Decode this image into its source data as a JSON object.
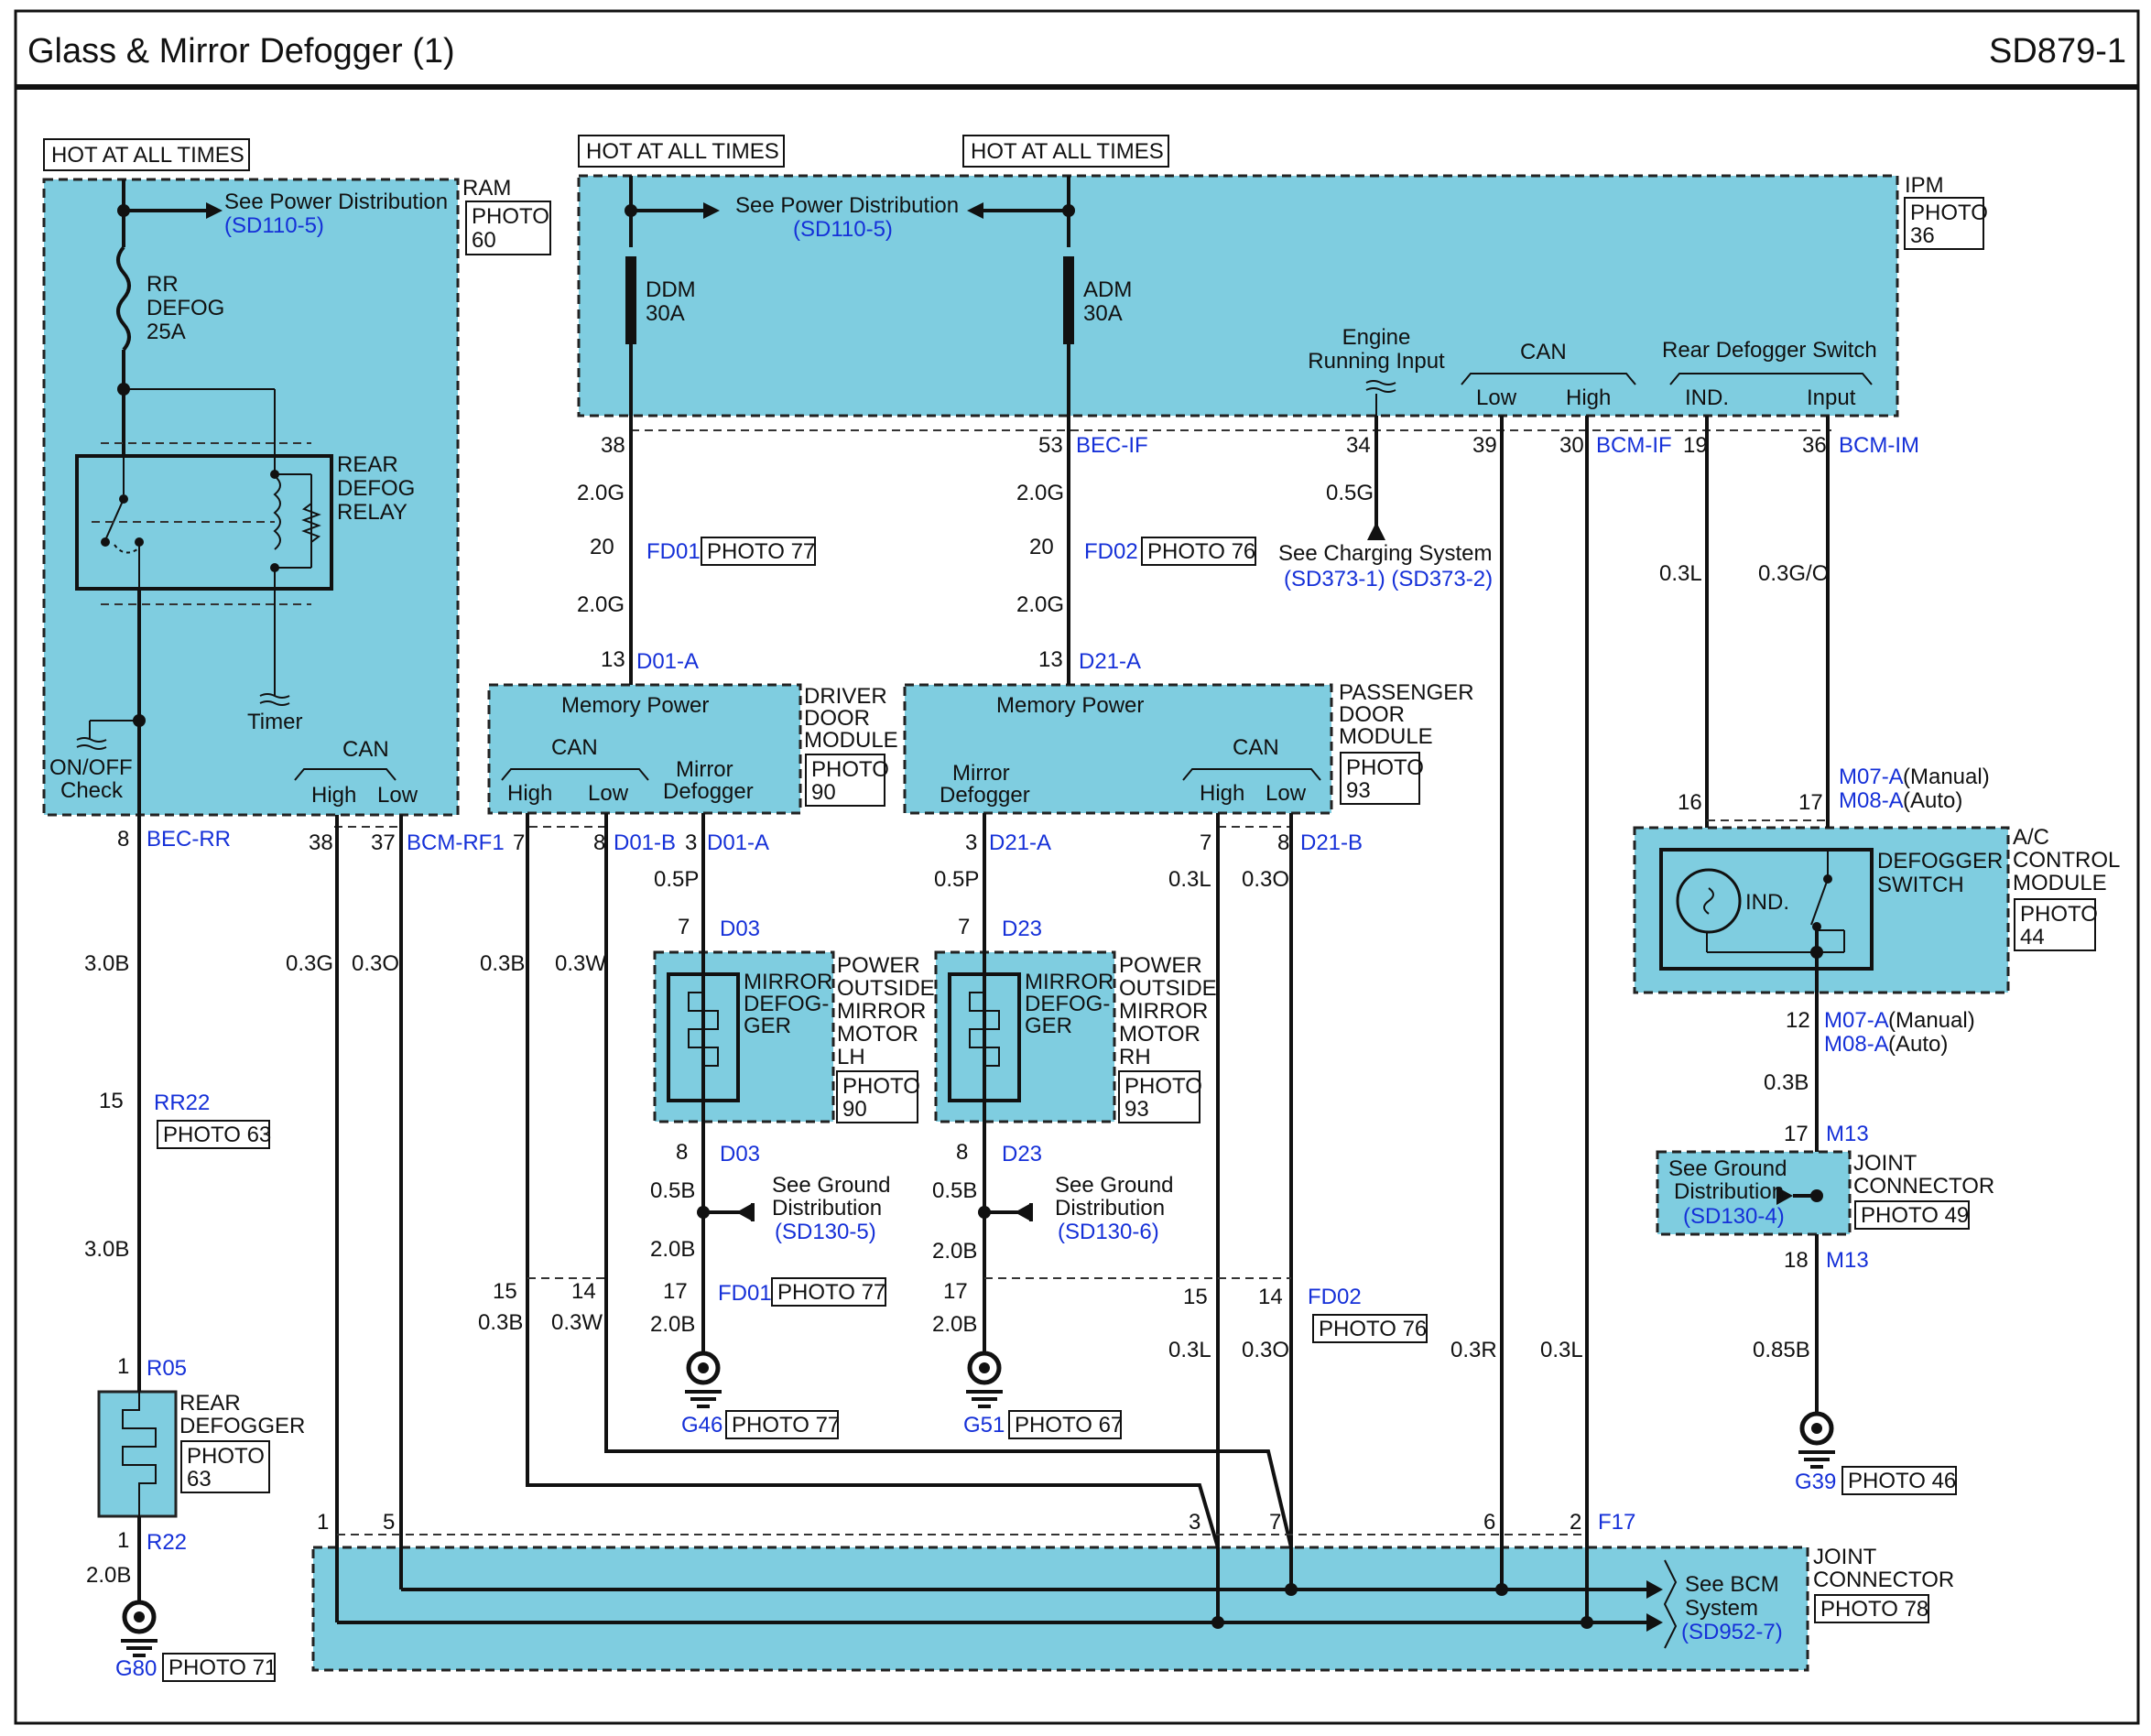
{
  "header": {
    "title": "Glass & Mirror Defogger (1)",
    "code": "SD879-1"
  },
  "hot": "HOT AT ALL TIMES",
  "see_power": "See Power Distribution",
  "sd110": "(SD110-5)",
  "ram": {
    "name": "RAM",
    "photo": [
      "PHOTO",
      "60"
    ],
    "fuse": [
      "RR",
      "DEFOG",
      "25A"
    ],
    "relay": [
      "REAR",
      "DEFOG",
      "RELAY"
    ],
    "timer": "Timer",
    "onoff": [
      "ON/OFF",
      "Check"
    ],
    "can": "CAN",
    "high": "High",
    "low": "Low"
  },
  "ipm": {
    "name": "IPM",
    "photo": [
      "PHOTO",
      "36"
    ],
    "ddm": [
      "DDM",
      "30A"
    ],
    "adm": [
      "ADM",
      "30A"
    ],
    "engine": [
      "Engine",
      "Running Input"
    ],
    "can": "CAN",
    "low": "Low",
    "high": "High",
    "rds": "Rear Defogger Switch",
    "ind": "IND.",
    "input": "Input"
  },
  "pins": {
    "p38": "38",
    "p53": "53",
    "bec_if": "BEC-IF",
    "p34": "34",
    "p39": "39",
    "p30": "30",
    "bcm_if": "BCM-IF",
    "p19": "19",
    "p36": "36",
    "bcm_im": "BCM-IM",
    "w20g_a": "2.0G",
    "w20g_b": "2.0G",
    "w20g_c": "2.0G",
    "w20g_d": "2.0G",
    "p20a": "20",
    "fd01": "FD01",
    "photo77": "PHOTO 77",
    "p20b": "20",
    "fd02": "FD02",
    "photo76": "PHOTO 76",
    "w05g": "0.5G",
    "see_charging": "See Charging System",
    "sd373": "(SD373-1) (SD373-2)",
    "w03l": "0.3L",
    "w03go": "0.3G/O",
    "p13a": "13",
    "d01a": "D01-A",
    "p13b": "13",
    "d21a": "D21-A"
  },
  "ddm_box": {
    "mem": "Memory Power",
    "can": "CAN",
    "high": "High",
    "low": "Low",
    "mirror": [
      "Mirror",
      "Defogger"
    ],
    "name": [
      "DRIVER",
      "DOOR",
      "MODULE"
    ],
    "photo": [
      "PHOTO",
      "90"
    ]
  },
  "pdm_box": {
    "mem": "Memory Power",
    "can": "CAN",
    "high": "High",
    "low": "Low",
    "mirror": [
      "Mirror",
      "Defogger"
    ],
    "name": [
      "PASSENGER",
      "DOOR",
      "MODULE"
    ],
    "photo": [
      "PHOTO",
      "93"
    ]
  },
  "mid": {
    "p8": "8",
    "bec_rr": "BEC-RR",
    "p38": "38",
    "p37": "37",
    "bcm_rf1": "BCM-RF1",
    "p7a": "7",
    "p8a": "8",
    "d01b": "D01-B",
    "p3a": "3",
    "d01a": "D01-A",
    "p3b": "3",
    "d21a": "D21-A",
    "p7b": "7",
    "p8b": "8",
    "d21b": "D21-B",
    "w30b": "3.0B",
    "w03g": "0.3G",
    "w03o": "0.3O",
    "w03b": "0.3B",
    "w03w": "0.3W",
    "w05p_a": "0.5P",
    "w05p_b": "0.5P",
    "w03l": "0.3L",
    "w03o_b": "0.3O"
  },
  "mirrors": {
    "p7a": "7",
    "d03": "D03",
    "p7b": "7",
    "d23": "D23",
    "label": [
      "MIRROR",
      "DEFOG-",
      "GER"
    ],
    "lh": [
      "POWER",
      "OUTSIDE",
      "MIRROR",
      "MOTOR",
      "LH"
    ],
    "rh": [
      "POWER",
      "OUTSIDE",
      "MIRROR",
      "MOTOR",
      "RH"
    ],
    "photo_lh": [
      "PHOTO",
      "90"
    ],
    "photo_rh": [
      "PHOTO",
      "93"
    ],
    "p8a": "8",
    "p8b": "8",
    "w05b_a": "0.5B",
    "w05b_b": "0.5B",
    "see_ground": [
      "See Ground",
      "Distribution"
    ],
    "sd130_5": "(SD130-5)",
    "sd130_6": "(SD130-6)"
  },
  "acm": {
    "m07": "M07-A",
    "manual": "(Manual)",
    "m08": "M08-A",
    "auto": "(Auto)",
    "p16": "16",
    "p17": "17",
    "ind": "IND.",
    "switch": [
      "DEFOGGER",
      "SWITCH"
    ],
    "name": [
      "A/C",
      "CONTROL",
      "MODULE"
    ],
    "photo": [
      "PHOTO",
      "44"
    ],
    "p12": "12",
    "w03b": "0.3B",
    "p17b": "17",
    "m13a": "M13",
    "p18": "18",
    "m13b": "M13",
    "see_ground": [
      "See Ground",
      "Distribution"
    ],
    "sd130_4": "(SD130-4)",
    "jc": [
      "JOINT",
      "CONNECTOR"
    ],
    "photo49": "PHOTO 49",
    "w085b": "0.85B",
    "g39": "G39",
    "photo46": "PHOTO 46"
  },
  "left": {
    "p15": "15",
    "rr22": "RR22",
    "photo63": "PHOTO 63",
    "w30b": "3.0B",
    "p1a": "1",
    "r05": "R05",
    "defogger": [
      "REAR",
      "DEFOGGER"
    ],
    "photo": [
      "PHOTO",
      "63"
    ],
    "p1b": "1",
    "r22": "R22",
    "w20b": "2.0B",
    "g80": "G80",
    "photo71": "PHOTO 71"
  },
  "lower": {
    "p15a": "15",
    "p14a": "14",
    "p17": "17",
    "fd01": "FD01",
    "photo77": "PHOTO 77",
    "w03b": "0.3B",
    "w03w": "0.3W",
    "w20b_a": "2.0B",
    "w20b_b": "2.0B",
    "w20b_c": "2.0B",
    "w20b_d": "2.0B",
    "g46": "G46",
    "photo77b": "PHOTO 77",
    "p17b": "17",
    "g51": "G51",
    "photo67": "PHOTO 67",
    "p15b": "15",
    "p14b": "14",
    "fd02": "FD02",
    "photo76": "PHOTO 76",
    "w03l": "0.3L",
    "w03o": "0.3O",
    "w03r": "0.3R",
    "w03l_b": "0.3L"
  },
  "bottom": {
    "p1": "1",
    "p5": "5",
    "p3": "3",
    "p7": "7",
    "p6": "6",
    "p2": "2",
    "f17": "F17",
    "see_bcm": [
      "See BCM",
      "System"
    ],
    "sd952": "(SD952-7)",
    "jc": [
      "JOINT",
      "CONNECTOR"
    ],
    "photo78": "PHOTO 78"
  }
}
